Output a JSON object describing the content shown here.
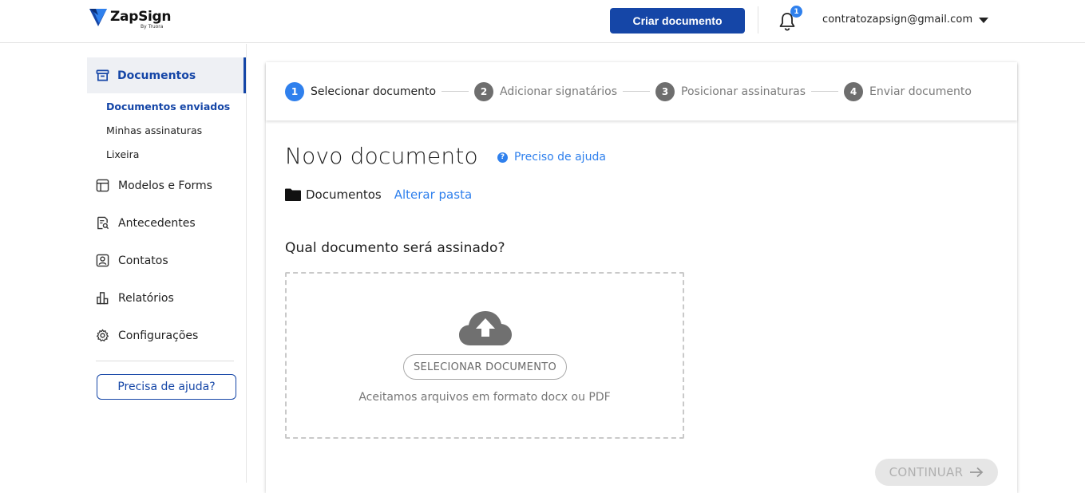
{
  "header": {
    "logo_name": "ZapSign",
    "logo_sub": "By Truora",
    "create_button": "Criar documento",
    "notification_count": "1",
    "user_email": "contratozapsign@gmail.com"
  },
  "sidebar": {
    "active_section": "Documentos",
    "sub_items": [
      {
        "label": "Documentos enviados",
        "active": true
      },
      {
        "label": "Minhas assinaturas",
        "active": false
      },
      {
        "label": "Lixeira",
        "active": false
      }
    ],
    "items": [
      {
        "label": "Modelos e Forms",
        "icon": "template-icon"
      },
      {
        "label": "Antecedentes",
        "icon": "background-check-icon"
      },
      {
        "label": "Contatos",
        "icon": "contact-icon"
      },
      {
        "label": "Relatórios",
        "icon": "chart-icon"
      },
      {
        "label": "Configurações",
        "icon": "gear-icon"
      }
    ],
    "help_button": "Precisa de ajuda?"
  },
  "stepper": {
    "steps": [
      {
        "num": "1",
        "label": "Selecionar documento",
        "active": true
      },
      {
        "num": "2",
        "label": "Adicionar signatários",
        "active": false
      },
      {
        "num": "3",
        "label": "Posicionar assinaturas",
        "active": false
      },
      {
        "num": "4",
        "label": "Enviar documento",
        "active": false
      }
    ]
  },
  "main": {
    "title": "Novo documento",
    "help_link": "Preciso de ajuda",
    "help_link_icon": "?",
    "folder_name": "Documentos",
    "change_folder": "Alterar pasta",
    "question": "Qual documento será assinado?",
    "select_button": "SELECIONAR DOCUMENTO",
    "accept_text": "Aceitamos arquivos em formato docx ou PDF",
    "continue_button": "CONTINUAR"
  },
  "colors": {
    "brand": "#1546a7",
    "accent": "#2f80ed"
  }
}
